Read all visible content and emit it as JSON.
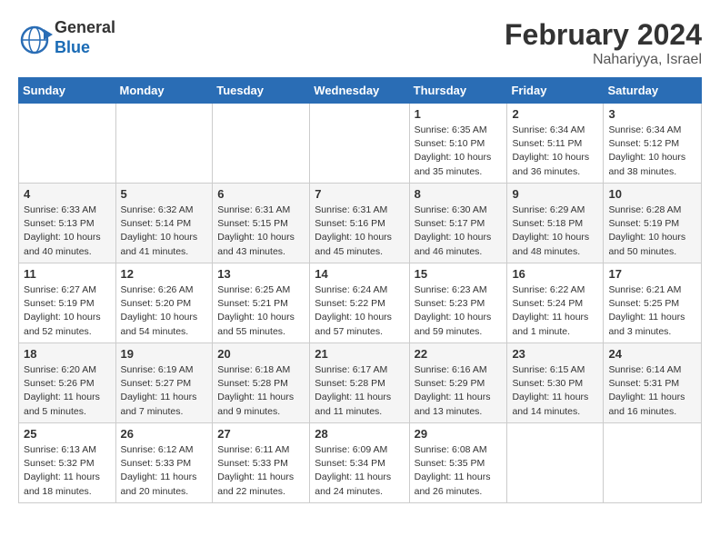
{
  "header": {
    "logo_line1": "General",
    "logo_line2": "Blue",
    "month": "February 2024",
    "location": "Nahariyya, Israel"
  },
  "weekdays": [
    "Sunday",
    "Monday",
    "Tuesday",
    "Wednesday",
    "Thursday",
    "Friday",
    "Saturday"
  ],
  "weeks": [
    [
      {
        "day": "",
        "text": ""
      },
      {
        "day": "",
        "text": ""
      },
      {
        "day": "",
        "text": ""
      },
      {
        "day": "",
        "text": ""
      },
      {
        "day": "1",
        "text": "Sunrise: 6:35 AM\nSunset: 5:10 PM\nDaylight: 10 hours\nand 35 minutes."
      },
      {
        "day": "2",
        "text": "Sunrise: 6:34 AM\nSunset: 5:11 PM\nDaylight: 10 hours\nand 36 minutes."
      },
      {
        "day": "3",
        "text": "Sunrise: 6:34 AM\nSunset: 5:12 PM\nDaylight: 10 hours\nand 38 minutes."
      }
    ],
    [
      {
        "day": "4",
        "text": "Sunrise: 6:33 AM\nSunset: 5:13 PM\nDaylight: 10 hours\nand 40 minutes."
      },
      {
        "day": "5",
        "text": "Sunrise: 6:32 AM\nSunset: 5:14 PM\nDaylight: 10 hours\nand 41 minutes."
      },
      {
        "day": "6",
        "text": "Sunrise: 6:31 AM\nSunset: 5:15 PM\nDaylight: 10 hours\nand 43 minutes."
      },
      {
        "day": "7",
        "text": "Sunrise: 6:31 AM\nSunset: 5:16 PM\nDaylight: 10 hours\nand 45 minutes."
      },
      {
        "day": "8",
        "text": "Sunrise: 6:30 AM\nSunset: 5:17 PM\nDaylight: 10 hours\nand 46 minutes."
      },
      {
        "day": "9",
        "text": "Sunrise: 6:29 AM\nSunset: 5:18 PM\nDaylight: 10 hours\nand 48 minutes."
      },
      {
        "day": "10",
        "text": "Sunrise: 6:28 AM\nSunset: 5:19 PM\nDaylight: 10 hours\nand 50 minutes."
      }
    ],
    [
      {
        "day": "11",
        "text": "Sunrise: 6:27 AM\nSunset: 5:19 PM\nDaylight: 10 hours\nand 52 minutes."
      },
      {
        "day": "12",
        "text": "Sunrise: 6:26 AM\nSunset: 5:20 PM\nDaylight: 10 hours\nand 54 minutes."
      },
      {
        "day": "13",
        "text": "Sunrise: 6:25 AM\nSunset: 5:21 PM\nDaylight: 10 hours\nand 55 minutes."
      },
      {
        "day": "14",
        "text": "Sunrise: 6:24 AM\nSunset: 5:22 PM\nDaylight: 10 hours\nand 57 minutes."
      },
      {
        "day": "15",
        "text": "Sunrise: 6:23 AM\nSunset: 5:23 PM\nDaylight: 10 hours\nand 59 minutes."
      },
      {
        "day": "16",
        "text": "Sunrise: 6:22 AM\nSunset: 5:24 PM\nDaylight: 11 hours\nand 1 minute."
      },
      {
        "day": "17",
        "text": "Sunrise: 6:21 AM\nSunset: 5:25 PM\nDaylight: 11 hours\nand 3 minutes."
      }
    ],
    [
      {
        "day": "18",
        "text": "Sunrise: 6:20 AM\nSunset: 5:26 PM\nDaylight: 11 hours\nand 5 minutes."
      },
      {
        "day": "19",
        "text": "Sunrise: 6:19 AM\nSunset: 5:27 PM\nDaylight: 11 hours\nand 7 minutes."
      },
      {
        "day": "20",
        "text": "Sunrise: 6:18 AM\nSunset: 5:28 PM\nDaylight: 11 hours\nand 9 minutes."
      },
      {
        "day": "21",
        "text": "Sunrise: 6:17 AM\nSunset: 5:28 PM\nDaylight: 11 hours\nand 11 minutes."
      },
      {
        "day": "22",
        "text": "Sunrise: 6:16 AM\nSunset: 5:29 PM\nDaylight: 11 hours\nand 13 minutes."
      },
      {
        "day": "23",
        "text": "Sunrise: 6:15 AM\nSunset: 5:30 PM\nDaylight: 11 hours\nand 14 minutes."
      },
      {
        "day": "24",
        "text": "Sunrise: 6:14 AM\nSunset: 5:31 PM\nDaylight: 11 hours\nand 16 minutes."
      }
    ],
    [
      {
        "day": "25",
        "text": "Sunrise: 6:13 AM\nSunset: 5:32 PM\nDaylight: 11 hours\nand 18 minutes."
      },
      {
        "day": "26",
        "text": "Sunrise: 6:12 AM\nSunset: 5:33 PM\nDaylight: 11 hours\nand 20 minutes."
      },
      {
        "day": "27",
        "text": "Sunrise: 6:11 AM\nSunset: 5:33 PM\nDaylight: 11 hours\nand 22 minutes."
      },
      {
        "day": "28",
        "text": "Sunrise: 6:09 AM\nSunset: 5:34 PM\nDaylight: 11 hours\nand 24 minutes."
      },
      {
        "day": "29",
        "text": "Sunrise: 6:08 AM\nSunset: 5:35 PM\nDaylight: 11 hours\nand 26 minutes."
      },
      {
        "day": "",
        "text": ""
      },
      {
        "day": "",
        "text": ""
      }
    ]
  ]
}
